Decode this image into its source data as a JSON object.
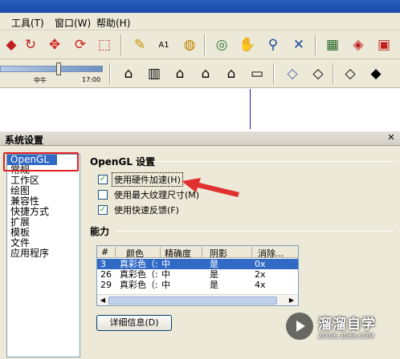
{
  "menu": {
    "tools": "工具(T)",
    "window": "窗口(W)",
    "help": "帮助(H)"
  },
  "toolbar1_icons": [
    "push-pull-icon",
    "rotate-icon",
    "move-icon",
    "refresh-icon",
    "scale-icon",
    "tape-measure-icon",
    "text-label-icon",
    "paint-bucket-icon",
    "orbit-icon",
    "pan-icon",
    "zoom-icon",
    "zoom-extents-icon",
    "component-icon",
    "materials-icon",
    "styles-icon"
  ],
  "toolbar2_icons": [
    "iso-house-icon",
    "front-view-icon",
    "house-icon",
    "right-view-icon",
    "back-view-icon",
    "left-view-icon",
    "xray-icon",
    "wireframe-icon",
    "hidden-line-icon",
    "shaded-icon"
  ],
  "shadow_slider": {
    "label_noon": "中午",
    "label_time": "17:00",
    "position": 0.56
  },
  "dialog": {
    "title": "系统设置",
    "categories": [
      {
        "label": "OpenGL",
        "selected": true
      },
      {
        "label": "常规",
        "selected": false
      },
      {
        "label": "工作区",
        "selected": false
      },
      {
        "label": "绘图",
        "selected": false
      },
      {
        "label": "兼容性",
        "selected": false
      },
      {
        "label": "快捷方式",
        "selected": false
      },
      {
        "label": "扩展",
        "selected": false
      },
      {
        "label": "模板",
        "selected": false
      },
      {
        "label": "文件",
        "selected": false
      },
      {
        "label": "应用程序",
        "selected": false
      }
    ],
    "opengl_section_title": "OpenGL 设置",
    "options": [
      {
        "label": "使用硬件加速(H)",
        "checked": true,
        "focused": true
      },
      {
        "label": "使用最大纹理尺寸(M)",
        "checked": false,
        "focused": false
      },
      {
        "label": "使用快速反馈(F)",
        "checked": true,
        "focused": false
      }
    ],
    "capability_title": "能力",
    "table": {
      "columns": [
        "#",
        "颜色",
        "精确度",
        "阴影",
        "消除..."
      ],
      "rows": [
        {
          "num": "3",
          "color": "真彩色（:",
          "precision": "中",
          "shadow": "是",
          "aa": "0x",
          "selected": true
        },
        {
          "num": "26",
          "color": "真彩色（:",
          "precision": "中",
          "shadow": "是",
          "aa": "2x",
          "selected": false
        },
        {
          "num": "29",
          "color": "真彩色（:",
          "precision": "中",
          "shadow": "是",
          "aa": "4x",
          "selected": false
        }
      ]
    },
    "details_button": "详细信息(D)"
  },
  "watermark": {
    "main": "溜溜自学",
    "sub": "ZIXUE.3D66.COM"
  },
  "colors": {
    "selection": "#316ac5",
    "highlight_box": "#e02020",
    "arrow": "#e03030"
  }
}
